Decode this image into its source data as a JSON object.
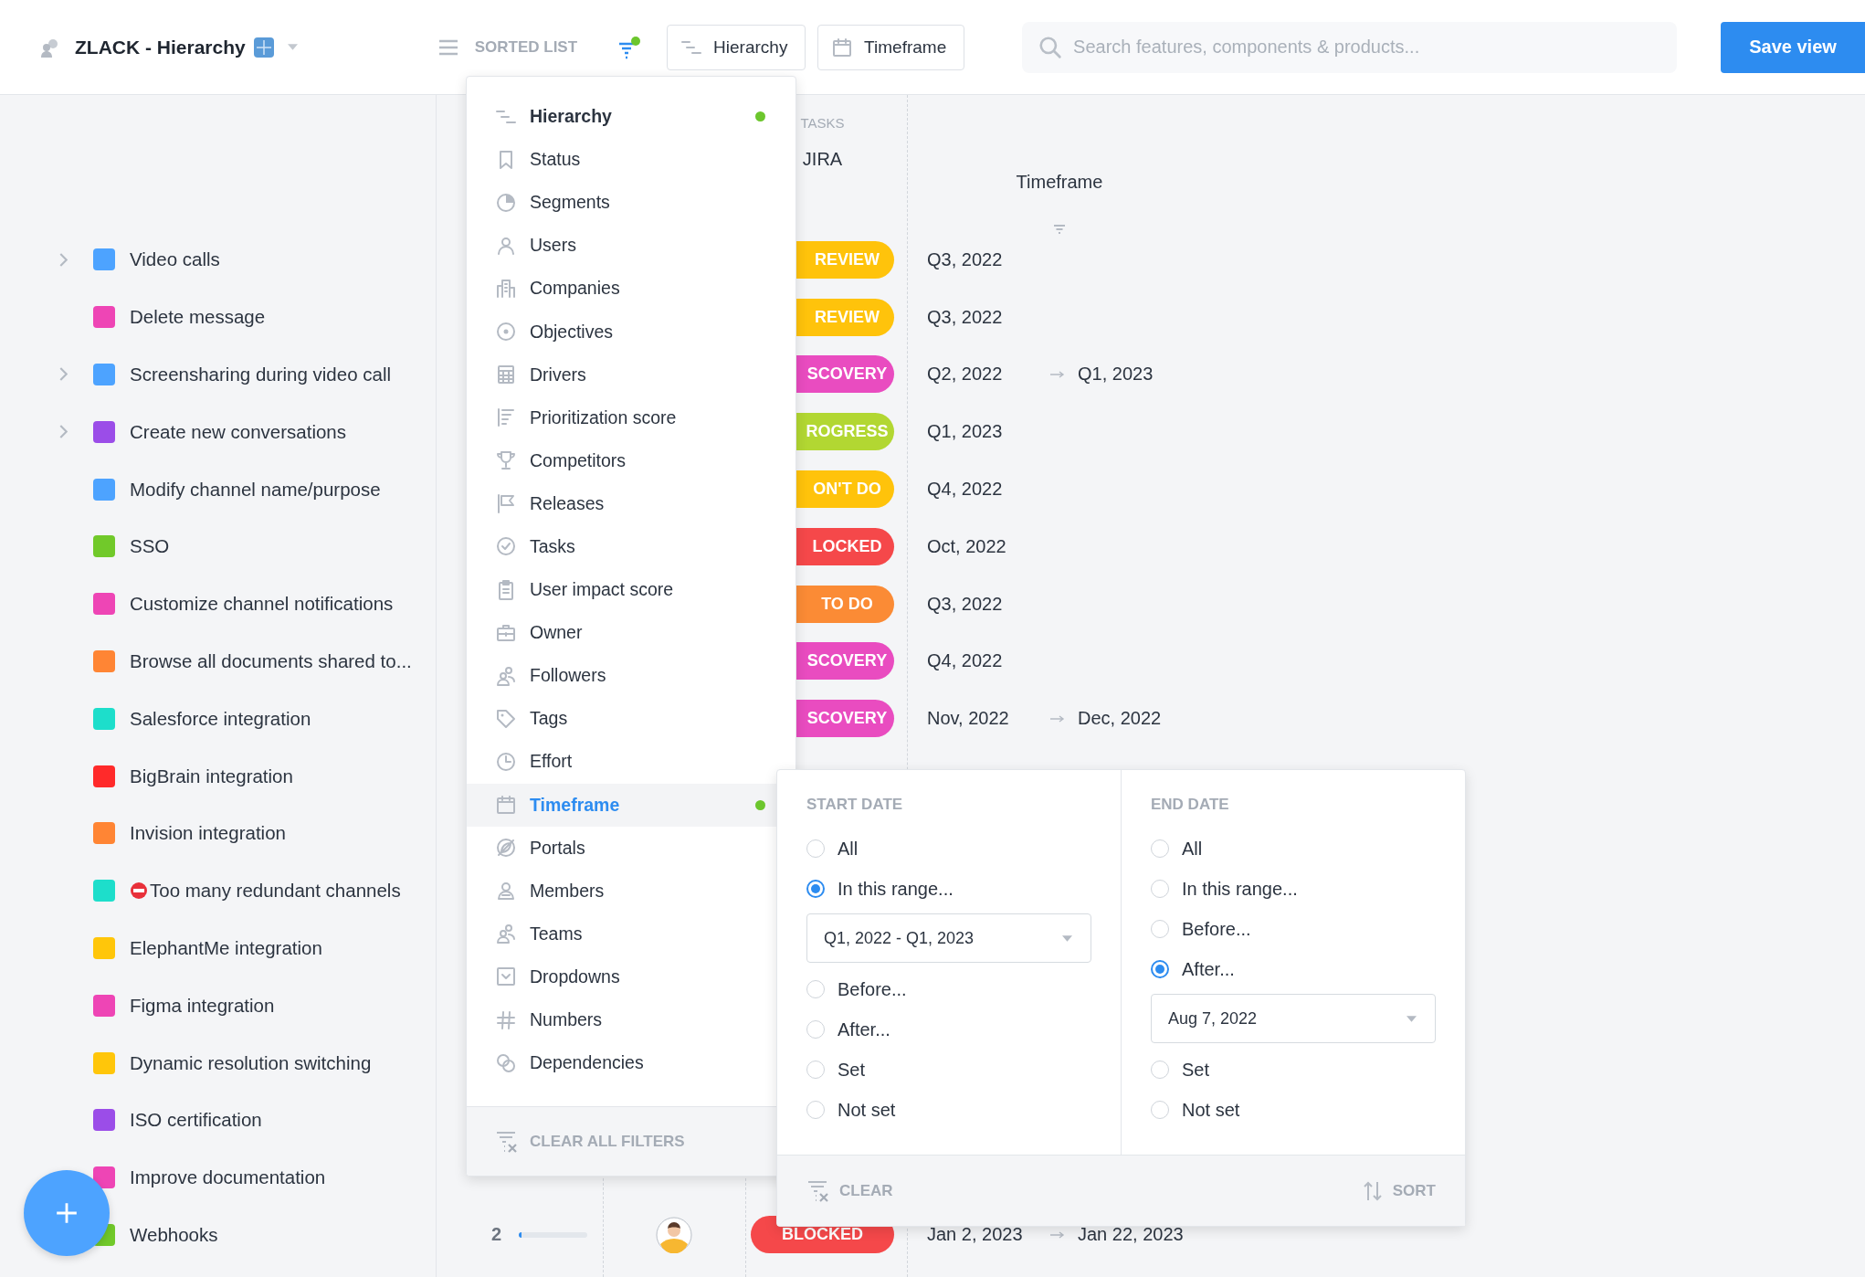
{
  "header": {
    "title": "ZLACK - Hierarchy",
    "view_mode": "SORTED LIST",
    "filter_active": true,
    "buttons": [
      {
        "label": "Hierarchy"
      },
      {
        "label": "Timeframe"
      }
    ],
    "search": {
      "placeholder": "Search features, components & products..."
    },
    "save_button": "Save view"
  },
  "sidebar": {
    "items": [
      {
        "label": "Video calls",
        "color": "#4da3ff",
        "expandable": true
      },
      {
        "label": "Delete message",
        "color": "#ee45b5",
        "expandable": false
      },
      {
        "label": "Screensharing during video call",
        "color": "#4da3ff",
        "expandable": true
      },
      {
        "label": "Create new conversations",
        "color": "#9b4de8",
        "expandable": true
      },
      {
        "label": "Modify channel name/purpose",
        "color": "#4da3ff",
        "expandable": false
      },
      {
        "label": "SSO",
        "color": "#71c92a",
        "expandable": false
      },
      {
        "label": "Customize channel notifications",
        "color": "#ee45b5",
        "expandable": false
      },
      {
        "label": "Browse all documents shared to...",
        "color": "#ff8534",
        "expandable": false
      },
      {
        "label": "Salesforce integration",
        "color": "#1ddecb",
        "expandable": false
      },
      {
        "label": "BigBrain integration",
        "color": "#ff2a2a",
        "expandable": false
      },
      {
        "label": "Invision integration",
        "color": "#ff8534",
        "expandable": false
      },
      {
        "label": "Too many redundant channels",
        "color": "#1ddecb",
        "expandable": false,
        "blocked": true
      },
      {
        "label": "ElephantMe integration",
        "color": "#ffc60a",
        "expandable": false
      },
      {
        "label": "Figma integration",
        "color": "#ee45b5",
        "expandable": false
      },
      {
        "label": "Dynamic resolution switching",
        "color": "#ffc60a",
        "expandable": false
      },
      {
        "label": "ISO certification",
        "color": "#9b4de8",
        "expandable": false
      },
      {
        "label": "Improve documentation",
        "color": "#ee45b5",
        "expandable": false
      },
      {
        "label": "Webhooks",
        "color": "#71c92a",
        "expandable": false
      }
    ]
  },
  "table": {
    "columns": [
      {
        "group": "TASKS",
        "label": "JIRA"
      },
      {
        "label": "Timeframe",
        "filter": true
      }
    ],
    "rows": [
      {
        "status": "REVIEW",
        "color": "#ffc30b",
        "start": "Q3, 2022"
      },
      {
        "status": "REVIEW",
        "color": "#ffc30b",
        "start": "Q3, 2022"
      },
      {
        "status": "SCOVERY",
        "color": "#e94cc0",
        "start": "Q2, 2022",
        "end": "Q1, 2023"
      },
      {
        "status": "ROGRESS",
        "color": "#b2d732",
        "start": "Q1, 2023"
      },
      {
        "status": "ON'T DO",
        "color": "#ffc30b",
        "start": "Q4, 2022"
      },
      {
        "status": "LOCKED",
        "color": "#f5484a",
        "start": "Oct, 2022"
      },
      {
        "status": "TO DO",
        "color": "#fb8b35",
        "start": "Q3, 2022"
      },
      {
        "status": "SCOVERY",
        "color": "#e94cc0",
        "start": "Q4, 2022"
      },
      {
        "status": "SCOVERY",
        "color": "#e94cc0",
        "start": "Nov, 2022",
        "end": "Dec, 2022"
      }
    ],
    "bottom_row": {
      "number": "2",
      "level": 0.03,
      "status": "BLOCKED",
      "color": "#f5484a",
      "start": "Jan 2, 2023",
      "end": "Jan 22, 2023"
    }
  },
  "field_menu": {
    "items": [
      {
        "label": "Hierarchy",
        "current": true,
        "filtered": true,
        "selected": false
      },
      {
        "label": "Status",
        "current": false,
        "filtered": false,
        "selected": false
      },
      {
        "label": "Segments",
        "current": false,
        "filtered": false,
        "selected": false
      },
      {
        "label": "Users",
        "current": false,
        "filtered": false,
        "selected": false
      },
      {
        "label": "Companies",
        "current": false,
        "filtered": false,
        "selected": false
      },
      {
        "label": "Objectives",
        "current": false,
        "filtered": false,
        "selected": false
      },
      {
        "label": "Drivers",
        "current": false,
        "filtered": false,
        "selected": false
      },
      {
        "label": "Prioritization score",
        "current": false,
        "filtered": false,
        "selected": false
      },
      {
        "label": "Competitors",
        "current": false,
        "filtered": false,
        "selected": false
      },
      {
        "label": "Releases",
        "current": false,
        "filtered": false,
        "selected": false
      },
      {
        "label": "Tasks",
        "current": false,
        "filtered": false,
        "selected": false
      },
      {
        "label": "User impact score",
        "current": false,
        "filtered": false,
        "selected": false
      },
      {
        "label": "Owner",
        "current": false,
        "filtered": false,
        "selected": false
      },
      {
        "label": "Followers",
        "current": false,
        "filtered": false,
        "selected": false
      },
      {
        "label": "Tags",
        "current": false,
        "filtered": false,
        "selected": false
      },
      {
        "label": "Effort",
        "current": false,
        "filtered": false,
        "selected": false
      },
      {
        "label": "Timeframe",
        "current": false,
        "filtered": true,
        "selected": true
      },
      {
        "label": "Portals",
        "current": false,
        "filtered": false,
        "selected": false
      },
      {
        "label": "Members",
        "current": false,
        "filtered": false,
        "selected": false
      },
      {
        "label": "Teams",
        "current": false,
        "filtered": false,
        "selected": false
      },
      {
        "label": "Dropdowns",
        "current": false,
        "filtered": false,
        "selected": false
      },
      {
        "label": "Numbers",
        "current": false,
        "filtered": false,
        "selected": false
      },
      {
        "label": "Dependencies",
        "current": false,
        "filtered": false,
        "selected": false
      }
    ],
    "footer": "CLEAR ALL FILTERS"
  },
  "date_filter": {
    "columns": [
      {
        "title": "START DATE",
        "options": [
          {
            "label": "All",
            "selected": false
          },
          {
            "label": "In this range...",
            "selected": true,
            "value": "Q1, 2022 - Q1, 2023"
          },
          {
            "label": "Before...",
            "selected": false
          },
          {
            "label": "After...",
            "selected": false
          },
          {
            "label": "Set",
            "selected": false
          },
          {
            "label": "Not set",
            "selected": false
          }
        ]
      },
      {
        "title": "END DATE",
        "options": [
          {
            "label": "All",
            "selected": false
          },
          {
            "label": "In this range...",
            "selected": false
          },
          {
            "label": "Before...",
            "selected": false
          },
          {
            "label": "After...",
            "selected": true,
            "value": "Aug 7, 2022"
          },
          {
            "label": "Set",
            "selected": false
          },
          {
            "label": "Not set",
            "selected": false
          }
        ]
      }
    ],
    "clear": "CLEAR",
    "sort": "SORT"
  }
}
